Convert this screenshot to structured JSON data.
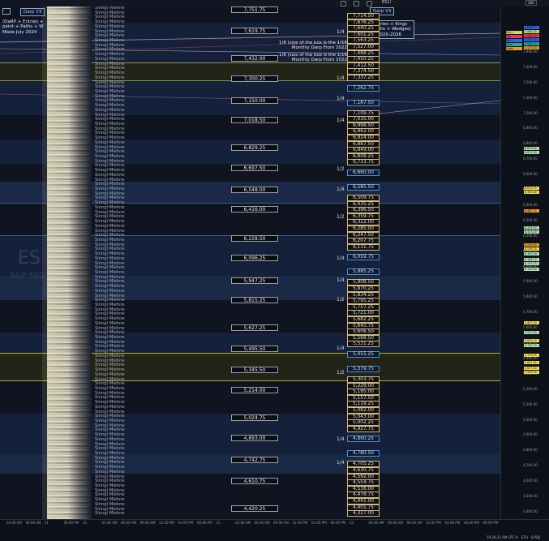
{
  "toolbar": {
    "symbol": "ES1!",
    "interval_box": "280"
  },
  "indicators": {
    "left_title": "Darp V3",
    "left_lines": [
      "(DaRP + Entries +",
      "point + Paths + W",
      "Made July 2024"
    ],
    "right_title": "Darp V4",
    "right_lines": [
      "Entries + Kings",
      "Paths + Wedges)",
      "y 2020-2026"
    ]
  },
  "watermark": {
    "symbol": "ES",
    "name": "S&P 500"
  },
  "box_notes": [
    {
      "line1": "1/8 (size of the box is the 1/16",
      "line2": "Monthly Darp From 2022"
    },
    {
      "line1": "1/8 (size of the box is the 1/16",
      "line2": "Monthly Darp From 2022"
    }
  ],
  "repeat_label": "Sinngl Mlehne",
  "mid_labels": [
    "7,751.75",
    "7,619.75",
    "7,432.00",
    "7,300.25",
    "7,150.00",
    "7,018.50",
    "6,829.25",
    "6,697.50",
    "6,548.00",
    "6,416.00",
    "6,228.50",
    "6,096.25",
    "5,947.25",
    "5,815.25",
    "5,627.25",
    "5,495.50",
    "5,345.50",
    "5,214.00",
    "5,024.75",
    "4,893.00",
    "4,742.75",
    "4,610.75",
    "4,420.25"
  ],
  "fractions": [
    "1/4",
    "1/4",
    "1/4",
    "1/4",
    "1/2",
    "1/4",
    "1/2",
    "1/4",
    "1/4",
    "1/2",
    "1/4",
    "1/2",
    "1/4",
    "1/4"
  ],
  "right_labels": [
    "7,714.50",
    "7,676.25",
    "7,640.25",
    "7,601.25",
    "7,563.25",
    "7,527.00",
    "7,488.25",
    "7,450.25",
    "7,412.50",
    "7,374.50",
    "7,337.25",
    "7,262.75",
    "7,187.50",
    "7,109.75",
    "7,035.00",
    "6,998.50",
    "6,962.00",
    "6,924.00",
    "6,887.50",
    "6,849.00",
    "6,808.25",
    "6,733.75",
    "6,660.00",
    "6,585.50",
    "6,509.75",
    "6,435.25",
    "6,396.50",
    "6,359.75",
    "6,322.00",
    "6,285.00",
    "6,247.50",
    "6,207.75",
    "6,131.75",
    "6,059.75",
    "5,985.25",
    "5,908.50",
    "5,870.25",
    "5,834.25",
    "5,795.25",
    "5,757.25",
    "5,721.00",
    "5,682.25",
    "5,645.75",
    "5,606.50",
    "5,568.50",
    "5,531.25",
    "5,455.25",
    "5,379.75",
    "5,303.75",
    "5,229.00",
    "5,195.00",
    "5,157.50",
    "5,119.25",
    "5,082.00",
    "5,043.00",
    "5,002.25",
    "4,927.75",
    "4,860.25",
    "4,780.50",
    "4,705.25",
    "4,630.75",
    "4,592.00",
    "4,554.75",
    "4,516.00",
    "4,478.75",
    "4,441.00",
    "4,401.75",
    "4,327.00"
  ],
  "axis_ticks": [
    "7,600.00",
    "7,400.00",
    "7,300.00",
    "7,200.00",
    "7,100.00",
    "7,000.00",
    "6,900.00",
    "6,800.00",
    "6,700.00",
    "6,600.00",
    "6,500.00",
    "6,400.00",
    "6,300.00",
    "6,200.00",
    "6,100.00",
    "6,000.00",
    "5,900.00",
    "5,800.00",
    "5,700.00",
    "5,600.00",
    "5,500.00",
    "5,400.00",
    "5,300.00",
    "5,200.00",
    "5,100.00",
    "5,000.00",
    "4,900.00",
    "4,800.00",
    "4,700.00",
    "4,600.00",
    "4,500.00",
    "4,400.00"
  ],
  "axis_tags": [
    {
      "text": "7,616.75",
      "color": "#2962ff"
    },
    {
      "text": "7,580.25",
      "color": "#c9d36a"
    },
    {
      "text": "7,558.50",
      "color": "#f23645"
    },
    {
      "text": "7,533.25",
      "color": "#2962ff"
    },
    {
      "text": "7,505.25",
      "color": "#22ab94"
    },
    {
      "text": "7,473.00",
      "color": "#e0a030"
    },
    {
      "text": "6,879.00",
      "color": "#b8e0b0"
    },
    {
      "text": "6,851.00",
      "color": "#b8e0b0"
    },
    {
      "text": "6,615.25",
      "color": "#f5e050"
    },
    {
      "text": "6,580.00",
      "color": "#f5e050"
    },
    {
      "text": "6,467.75",
      "color": "#f5a020"
    },
    {
      "text": "6,343.00",
      "color": "#b8e0b0"
    },
    {
      "text": "6,323.25",
      "color": "#b8e0b0"
    },
    {
      "text": "6,259.00",
      "color": "#f5a020"
    },
    {
      "text": "6,236.50",
      "color": "#f5e050"
    },
    {
      "text": "6,187.50",
      "color": "#b8e0b0"
    },
    {
      "text": "6,166.50",
      "color": "#b8e0b0"
    },
    {
      "text": "6,153.25",
      "color": "#b8e0b0"
    },
    {
      "text": "6,140.00",
      "color": "#b8e0b0"
    },
    {
      "text": "5,987.50",
      "color": "#f5e050"
    },
    {
      "text": "5,922.00",
      "color": "#b8e0b0"
    },
    {
      "text": "5,830.50",
      "color": "#f5e050"
    },
    {
      "text": "5,793.25",
      "color": "#b8e0b0"
    },
    {
      "text": "5,733.50",
      "color": "#f5e050"
    },
    {
      "text": "5,681.00",
      "color": "#f5e050"
    },
    {
      "text": "5,627.00",
      "color": "#f5e050"
    },
    {
      "text": "5,599.00",
      "color": "#f5e050"
    }
  ],
  "axis_top_tags": [
    {
      "text": "Day L",
      "color": "#c9d36a"
    },
    {
      "text": "Shp",
      "color": "#f23645"
    },
    {
      "text": "Mid",
      "color": "#2962ff"
    },
    {
      "text": "Pivot",
      "color": "#22ab94"
    },
    {
      "text": "Globx",
      "color": "#e0a030"
    }
  ],
  "time_ticks": [
    "04:00 AM",
    "09:00 AM",
    "21",
    "09:00 PM",
    "22",
    "03:00 AM",
    "06:00 AM",
    "09:00 AM",
    "12:00 PM",
    "03:00 PM",
    "06:00 PM",
    "23",
    "03:00 AM",
    "06:00 AM",
    "09:00 AM",
    "12:00 PM",
    "03:00 PM",
    "06:00 PM",
    "24",
    "03:00 AM",
    "06:00 AM",
    "09:00 AM",
    "12:00 PM",
    "03:00 PM",
    "06:00 PM",
    "09:00 PM"
  ],
  "status": {
    "time": "10:26:23 AM UTC-4",
    "session": "ETH",
    "mode": "B-ADJ"
  }
}
